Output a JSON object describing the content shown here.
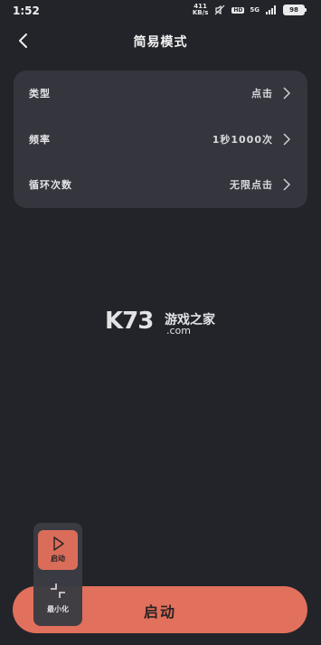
{
  "status": {
    "time": "1:52",
    "net_speed_value": "411",
    "net_speed_unit": "KB/s",
    "hd_label": "HD",
    "signal_label": "5G",
    "battery": "98"
  },
  "header": {
    "title": "简易模式"
  },
  "settings": {
    "rows": [
      {
        "label": "类型",
        "value": "点击"
      },
      {
        "label": "频率",
        "value": "1秒1000次"
      },
      {
        "label": "循环次数",
        "value": "无限点击"
      }
    ]
  },
  "watermark": {
    "brand": "K73",
    "cn": "游戏之家",
    "domain": ".com"
  },
  "float_panel": {
    "start_label": "启动",
    "minimize_label": "最小化"
  },
  "start_button": {
    "label": "启动"
  },
  "colors": {
    "background": "#23242a",
    "card": "#34353d",
    "accent": "#e1705c"
  }
}
